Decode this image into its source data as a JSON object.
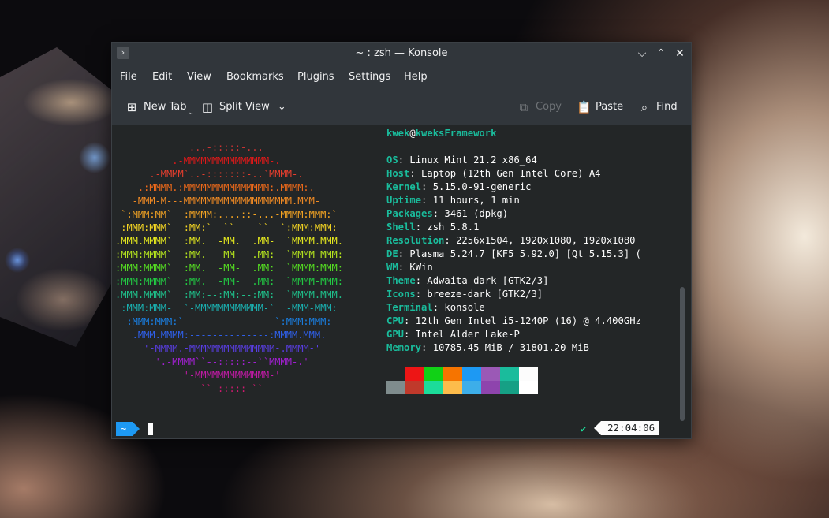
{
  "window": {
    "title": "~ : zsh — Konsole",
    "controls": [
      "minimize",
      "maximize",
      "close"
    ]
  },
  "menu": [
    "File",
    "Edit",
    "View",
    "Bookmarks",
    "Plugins",
    "Settings",
    "Help"
  ],
  "toolbar": {
    "new_tab": "New Tab",
    "split_view": "Split View",
    "copy": "Copy",
    "paste": "Paste",
    "find": "Find"
  },
  "terminal": {
    "logo_lines": [
      {
        "text": "             ...-:::::-...",
        "color": "#cc3333"
      },
      {
        "text": "          .-MMMMMMMMMMMMMMM-.",
        "color": "#e01919"
      },
      {
        "text": "      .-MMMM`..-:::::::-..`MMMM-.",
        "color": "#e53e2e"
      },
      {
        "text": "    .:MMMM.:MMMMMMMMMMMMMMM:.MMMM:.",
        "color": "#ef6a1a"
      },
      {
        "text": "   -MMM-M---MMMMMMMMMMMMMMMMMMM.MMM-",
        "color": "#f08a24"
      },
      {
        "text": " `:MMM:MM`  :MMMM:....::-...-MMMM:MMM:`",
        "color": "#f6a623"
      },
      {
        "text": " :MMM:MMM`  :MM:`  ``    ``  `:MMM:MMM:",
        "color": "#f5d623"
      },
      {
        "text": ".MMM.MMMM`  :MM.  -MM.  .MM-  `MMMM.MMM.",
        "color": "#e4e81f"
      },
      {
        "text": ":MMM:MMMM`  :MM.  -MM-  .MM:  `MMMM-MMM:",
        "color": "#b6e61e"
      },
      {
        "text": ":MMM:MMMM`  :MM.  -MM-  .MM:  `MMMM:MMM:",
        "color": "#55dd22"
      },
      {
        "text": ":MMM:MMMM`  :MM.  -MM-  .MM:  `MMMM-MMM:",
        "color": "#22cc44"
      },
      {
        "text": ".MMM.MMMM`  :MM:--:MM:--:MM:  `MMMM.MMM.",
        "color": "#1fbf8a"
      },
      {
        "text": " :MMM:MMM-  `-MMMMMMMMMMMM-`  -MMM-MMM:",
        "color": "#1ab0b0"
      },
      {
        "text": "  :MMM:MMM:`                `:MMM:MMM:",
        "color": "#1a7ee0"
      },
      {
        "text": "   .MMM.MMMM:--------------:MMMM.MMM.",
        "color": "#2f5fe8"
      },
      {
        "text": "     '-MMMM.-MMMMMMMMMMMMMMM-.MMMM-'",
        "color": "#5a3ee6"
      },
      {
        "text": "       '.-MMMM``--:::::--``MMMM-.'",
        "color": "#a020d0"
      },
      {
        "text": "            '-MMMMMMMMMMMMM-'",
        "color": "#c21aa6"
      },
      {
        "text": "               ``-:::::-``",
        "color": "#d01a70"
      }
    ],
    "user": "kwek",
    "host": "kweksFramework",
    "separator": "-------------------",
    "info": [
      {
        "key": "OS",
        "value": "Linux Mint 21.2 x86_64"
      },
      {
        "key": "Host",
        "value": "Laptop (12th Gen Intel Core) A4"
      },
      {
        "key": "Kernel",
        "value": "5.15.0-91-generic"
      },
      {
        "key": "Uptime",
        "value": "11 hours, 1 min"
      },
      {
        "key": "Packages",
        "value": "3461 (dpkg)"
      },
      {
        "key": "Shell",
        "value": "zsh 5.8.1"
      },
      {
        "key": "Resolution",
        "value": "2256x1504, 1920x1080, 1920x1080"
      },
      {
        "key": "DE",
        "value": "Plasma 5.24.7 [KF5 5.92.0] [Qt 5.15.3] ("
      },
      {
        "key": "WM",
        "value": "KWin"
      },
      {
        "key": "Theme",
        "value": "Adwaita-dark [GTK2/3]"
      },
      {
        "key": "Icons",
        "value": "breeze-dark [GTK2/3]"
      },
      {
        "key": "Terminal",
        "value": "konsole"
      },
      {
        "key": "CPU",
        "value": "12th Gen Intel i5-1240P (16) @ 4.400GHz"
      },
      {
        "key": "GPU",
        "value": "Intel Alder Lake-P"
      },
      {
        "key": "Memory",
        "value": "10785.45 MiB / 31801.20 MiB"
      }
    ],
    "palette_top": [
      "#232627",
      "#ed1515",
      "#11d116",
      "#f67400",
      "#1d99f3",
      "#9b59b6",
      "#1abc9c",
      "#fcfcfc"
    ],
    "palette_bottom": [
      "#7f8c8d",
      "#c0392b",
      "#1cdc9a",
      "#fdbc4b",
      "#3daee9",
      "#8e44ad",
      "#16a085",
      "#ffffff"
    ],
    "prompt_dir": "~",
    "status_check": "✔",
    "clock": "22:04:06"
  }
}
